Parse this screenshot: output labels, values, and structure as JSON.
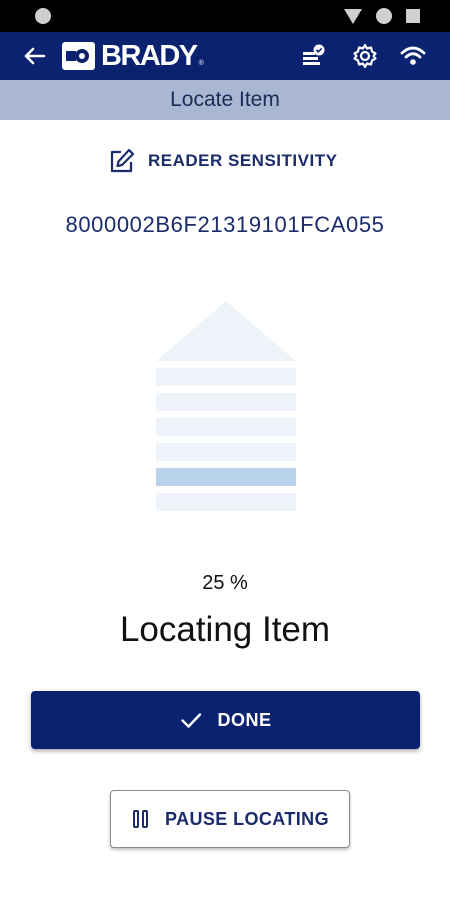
{
  "header": {
    "brand": "BRADY",
    "title": "Locate Item"
  },
  "icons": {
    "back": "arrow-left-icon",
    "reader_status": "reader-connected-icon",
    "settings": "gear-icon",
    "wifi": "wifi-icon",
    "edit": "edit-icon",
    "check": "check-icon",
    "pause": "pause-icon"
  },
  "sensitivity": {
    "label": "READER SENSITIVITY"
  },
  "tag": {
    "epc": "8000002B6F21319101FCA055"
  },
  "locator": {
    "progress_percent": 25,
    "progress_text": "25 %",
    "status": "Locating Item"
  },
  "actions": {
    "done_label": "DONE",
    "pause_label": "PAUSE LOCATING"
  },
  "colors": {
    "primary": "#0b2270",
    "title_band": "#a9b7d2",
    "indicator_active": "#b9d3ec",
    "indicator_inactive": "#eef3fa"
  }
}
